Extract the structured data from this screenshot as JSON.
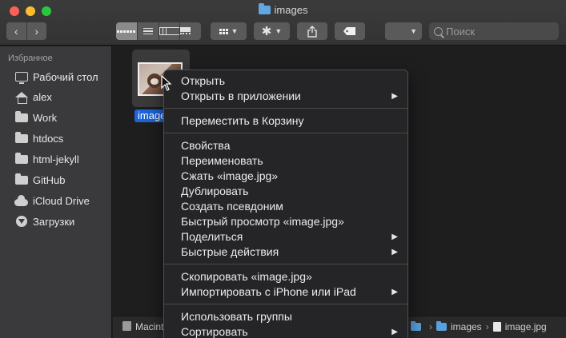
{
  "window": {
    "title": "images"
  },
  "toolbar": {
    "back": "‹",
    "forward": "›",
    "search_placeholder": "Поиск"
  },
  "sidebar": {
    "heading": "Избранное",
    "items": [
      {
        "label": "Рабочий стол",
        "icon": "desktop-icon"
      },
      {
        "label": "alex",
        "icon": "home-icon"
      },
      {
        "label": "Work",
        "icon": "folder-icon"
      },
      {
        "label": "htdocs",
        "icon": "folder-icon"
      },
      {
        "label": "html-jekyll",
        "icon": "folder-icon"
      },
      {
        "label": "GitHub",
        "icon": "folder-icon"
      },
      {
        "label": "iCloud Drive",
        "icon": "cloud-icon"
      },
      {
        "label": "Загрузки",
        "icon": "download-icon"
      }
    ]
  },
  "content": {
    "file_label": "image"
  },
  "pathbar": {
    "disk": "Macint",
    "folder": "images",
    "file": "image.jpg"
  },
  "context_menu": {
    "items": [
      {
        "label": "Открыть",
        "submenu": false
      },
      {
        "label": "Открыть в приложении",
        "submenu": true
      },
      {
        "label": "Переместить в Корзину",
        "submenu": false
      },
      {
        "label": "Свойства",
        "submenu": false
      },
      {
        "label": "Переименовать",
        "submenu": false
      },
      {
        "label": "Сжать «image.jpg»",
        "submenu": false
      },
      {
        "label": "Дублировать",
        "submenu": false
      },
      {
        "label": "Создать псевдоним",
        "submenu": false
      },
      {
        "label": "Быстрый просмотр «image.jpg»",
        "submenu": false
      },
      {
        "label": "Поделиться",
        "submenu": true
      },
      {
        "label": "Быстрые действия",
        "submenu": true
      },
      {
        "label": "Скопировать «image.jpg»",
        "submenu": false
      },
      {
        "label": "Импортировать с iPhone или iPad",
        "submenu": true
      },
      {
        "label": "Использовать группы",
        "submenu": false
      },
      {
        "label": "Сортировать",
        "submenu": true
      }
    ]
  }
}
